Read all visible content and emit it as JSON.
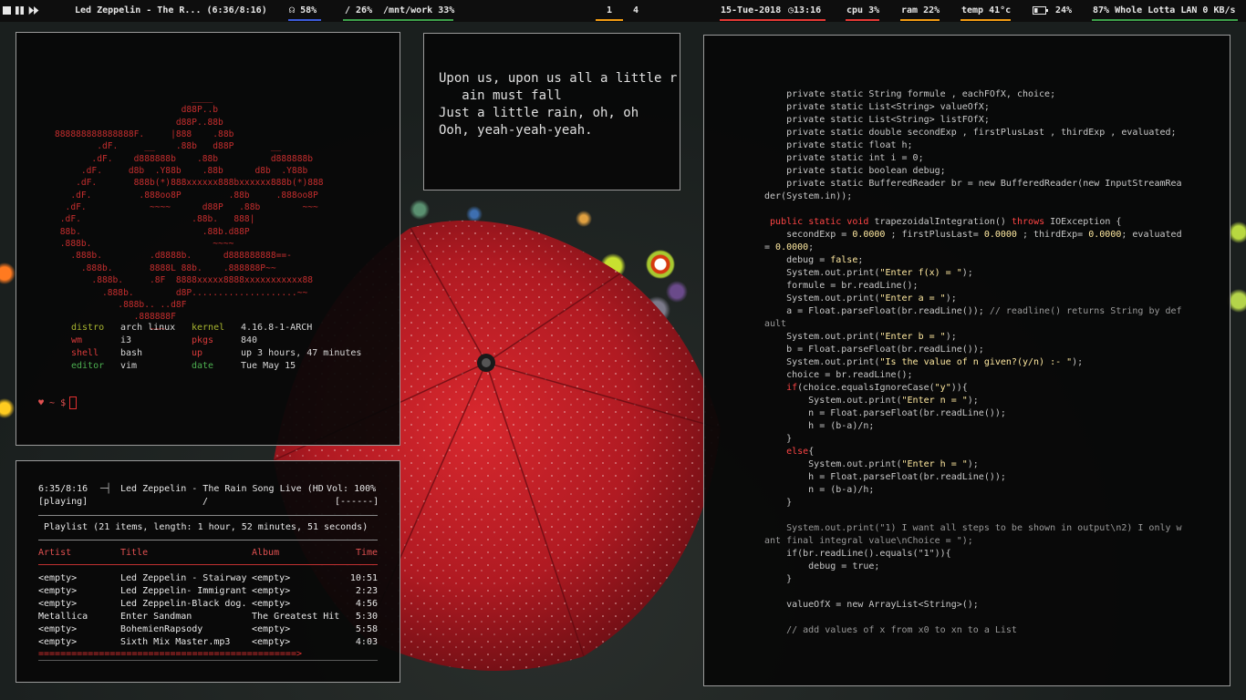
{
  "topbar": {
    "media_title": "Led Zeppelin - The R... (6:36/8:16)",
    "volume": "58%",
    "disk_root": "/ 26%",
    "disk_work": "/mnt/work 33%",
    "workspaces": [
      "1",
      "4"
    ],
    "date": "15-Tue-2018",
    "time": "13:16",
    "cpu": "cpu 3%",
    "ram": "ram 22%",
    "temp": "temp 41°c",
    "battery": "24%",
    "network": "87% Whole Lotta LAN 0 KB/s",
    "colors": {
      "accent_red": "#e53935",
      "accent_blue": "#3b5bdb",
      "accent_green": "#3da04a",
      "accent_orange": "#f39c12"
    },
    "icons": [
      "stop-icon",
      "pause-icon",
      "next-icon",
      "headphones-icon",
      "clock-icon",
      "battery-icon"
    ]
  },
  "neofetch": {
    "art": "                          ____\n                        d88P..b\n                       d88P..88b\n888888888888888F.     |888    .88b\n        .dF.     __    .88b   d88P       __\n       .dF.    d888888b    .88b          d888888b\n     .dF.     d8b  .Y88b    .88b      d8b  .Y88b\n    .dF.       888b(*)888xxxxxx888bxxxxxx888b(*)888\n   .dF.         .888oo8P         .88b     .888oo8P\n  .dF.            ~~~~      d88P   .88b        ~~~\n .dF.                     .88b.   888|\n 88b.                       .88b.d88P\n .888b.                       ~~~~\n   .888b.         .d8888b.      d888888888==-\n     .888b.       8888L 88b.    .888888P~~\n       .888b.     .8F  8888xxxxx8888xxxxxxxxxxx88\n         .888b.        d8P....................~~\n            .888b.. ..d8F\n               .888888F\n                  ~~~",
    "info": [
      {
        "k1": "distro",
        "v1": "arch linux",
        "k2": "kernel",
        "v2": "4.16.8-1-ARCH",
        "color": "#a8b530"
      },
      {
        "k1": "wm",
        "v1": "i3",
        "k2": "pkgs",
        "v2": "840",
        "color": "#d83a3a"
      },
      {
        "k1": "shell",
        "v1": "bash",
        "k2": "up",
        "v2": "up 3 hours, 47 minutes",
        "color": "#d83a3a"
      },
      {
        "k1": "editor",
        "v1": "vim",
        "k2": "date",
        "v2": "Tue May 15",
        "color": "#4caf50"
      }
    ],
    "prompt": "♥ ~ $"
  },
  "lyrics": {
    "lines": [
      "Upon us, upon us all a little r",
      "   ain must fall",
      "Just a little rain, oh, oh",
      "Ooh, yeah-yeah-yeah."
    ]
  },
  "player": {
    "elapsed": "6:35/8:16",
    "now_playing": "Led Zeppelin - The Rain Song Live (HD",
    "volume": "Vol: 100%",
    "state": "[playing]",
    "slash": "/",
    "flags": "[------]",
    "playlist_info": "Playlist (21 items, length: 1 hour, 52 minutes, 51 seconds)",
    "headers": {
      "artist": "Artist",
      "title": "Title",
      "album": "Album",
      "time": "Time"
    },
    "tracks": [
      {
        "artist": "<empty>",
        "title": "Led Zeppelin - Stairway",
        "album": "<empty>",
        "time": "10:51"
      },
      {
        "artist": "<empty>",
        "title": "Led Zeppelin- Immigrant",
        "album": "<empty>",
        "time": "2:23"
      },
      {
        "artist": "<empty>",
        "title": "Led Zeppelin-Black dog.",
        "album": "<empty>",
        "time": "4:56"
      },
      {
        "artist": "Metallica",
        "title": "Enter Sandman",
        "album": "The Greatest Hit",
        "time": "5:30"
      },
      {
        "artist": "<empty>",
        "title": "BohemienRapsody",
        "album": "<empty>",
        "time": "5:58"
      },
      {
        "artist": "<empty>",
        "title": "Sixth Mix Master.mp3",
        "album": "<empty>",
        "time": "4:03"
      }
    ],
    "progress_bar": "===============================================>",
    "progress": 0.79
  },
  "code": {
    "lines": [
      {
        "t": "    private static String formule , eachFOfX, choice;",
        "c": ""
      },
      {
        "t": "    private static List<String> valueOfX;",
        "c": ""
      },
      {
        "t": "    private static List<String> listFOfX;",
        "c": ""
      },
      {
        "t": "    private static double secondExp , firstPlusLast , thirdExp , evaluated;",
        "c": ""
      },
      {
        "t": "    private static float h;",
        "c": ""
      },
      {
        "t": "    private static int i = 0;",
        "c": ""
      },
      {
        "t": "    private static boolean debug;",
        "c": ""
      },
      {
        "t": "    private static BufferedReader br = new BufferedReader(new InputStreamRea",
        "c": ""
      },
      {
        "t": "der(System.in));",
        "c": ""
      },
      {
        "t": "",
        "c": ""
      },
      {
        "t": " public static void trapezoidalIntegration() throws IOException {",
        "c": "sig"
      },
      {
        "t": "    secondExp = 0.0000 ; firstPlusLast= 0.0000 ; thirdExp= 0.0000; evaluated",
        "c": "num"
      },
      {
        "t": "= 0.0000;",
        "c": "num"
      },
      {
        "t": "    debug = false;",
        "c": "num"
      },
      {
        "t": "    System.out.print(\"Enter f(x) = \");",
        "c": "str"
      },
      {
        "t": "    formule = br.readLine();",
        "c": ""
      },
      {
        "t": "    System.out.print(\"Enter a = \");",
        "c": "str"
      },
      {
        "t": "    a = Float.parseFloat(br.readLine()); // readline() returns String by def",
        "c": "cmtpart"
      },
      {
        "t": "ault",
        "c": "cmt"
      },
      {
        "t": "    System.out.print(\"Enter b = \");",
        "c": "str"
      },
      {
        "t": "    b = Float.parseFloat(br.readLine());",
        "c": ""
      },
      {
        "t": "    System.out.print(\"Is the value of n given?(y/n) :- \");",
        "c": "str"
      },
      {
        "t": "    choice = br.readLine();",
        "c": ""
      },
      {
        "t": "    if(choice.equalsIgnoreCase(\"y\")){",
        "c": "if"
      },
      {
        "t": "        System.out.print(\"Enter n = \");",
        "c": "str"
      },
      {
        "t": "        n = Float.parseFloat(br.readLine());",
        "c": ""
      },
      {
        "t": "        h = (b-a)/n;",
        "c": ""
      },
      {
        "t": "    }",
        "c": ""
      },
      {
        "t": "    else{",
        "c": "else"
      },
      {
        "t": "        System.out.print(\"Enter h = \");",
        "c": "str"
      },
      {
        "t": "        h = Float.parseFloat(br.readLine());",
        "c": ""
      },
      {
        "t": "        n = (b-a)/h;",
        "c": ""
      },
      {
        "t": "    }",
        "c": ""
      },
      {
        "t": "",
        "c": ""
      },
      {
        "t": "    System.out.print(\"1) I want all steps to be shown in output\\n2) I only w",
        "c": "cmt"
      },
      {
        "t": "ant final integral value\\nChoice = \");",
        "c": "cmt"
      },
      {
        "t": "    if(br.readLine().equals(\"1\")){",
        "c": ""
      },
      {
        "t": "        debug = true;",
        "c": ""
      },
      {
        "t": "    }",
        "c": ""
      },
      {
        "t": "",
        "c": ""
      },
      {
        "t": "    valueOfX = new ArrayList<String>();",
        "c": ""
      },
      {
        "t": "",
        "c": ""
      },
      {
        "t": "    // add values of x from x0 to xn to a List",
        "c": "cmt"
      }
    ]
  }
}
